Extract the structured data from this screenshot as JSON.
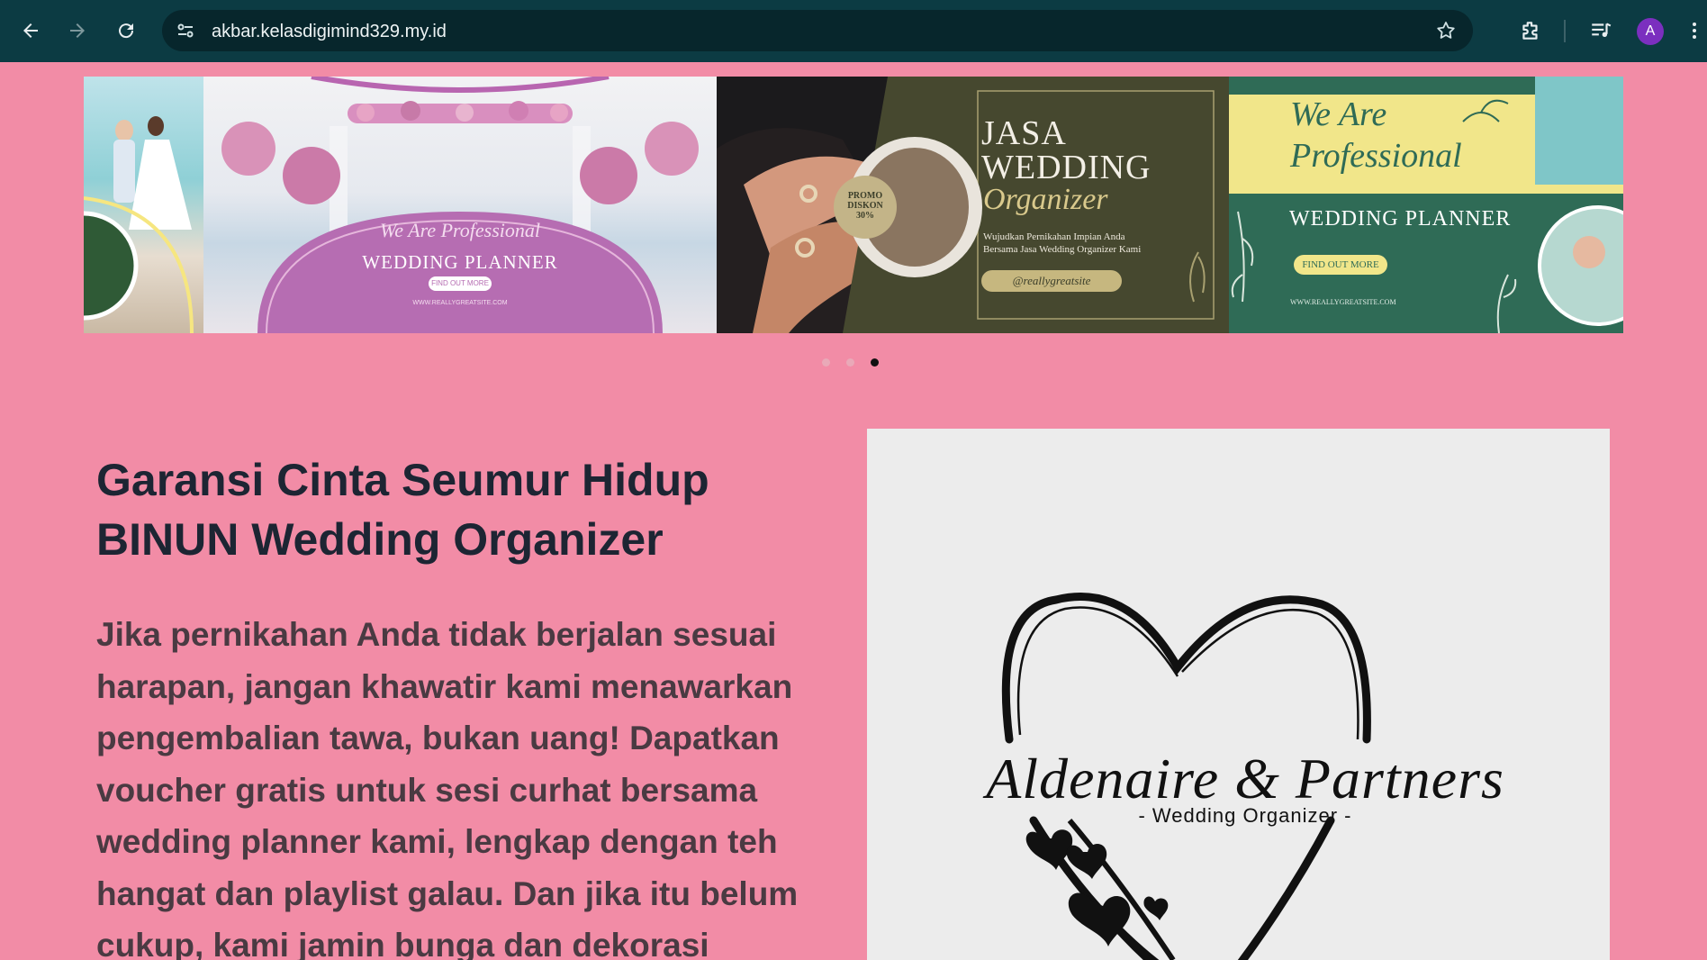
{
  "browser": {
    "url": "akbar.kelasdigimind329.my.id",
    "profile_initial": "A",
    "icons": [
      "back-icon",
      "forward-icon",
      "reload-icon",
      "site-info-icon",
      "bookmark-star-icon",
      "extensions-icon",
      "media-control-icon",
      "more-menu-icon"
    ]
  },
  "carousel": {
    "active_index": 2,
    "dot_count": 3,
    "slides": [
      {
        "script_line": "We Are Professional",
        "heading": "WEDDING PLANNER",
        "button": "FIND OUT MORE",
        "footer": "WWW.REALLYGREATSITE.COM"
      },
      {
        "heading_1": "JASA",
        "heading_2": "WEDDING",
        "script": "Organizer",
        "promo": [
          "PROMO",
          "DISKON",
          "30%"
        ],
        "tagline_1": "Wujudkan Pernikahan Impian Anda",
        "tagline_2": "Bersama Jasa Wedding Organizer Kami",
        "handle": "@reallygreatsite"
      },
      {
        "script_1": "We Are",
        "script_2": "Professional",
        "heading": "WEDDING PLANNER",
        "button": "FIND OUT MORE",
        "footer": "WWW.REALLYGREATSITE.COM"
      }
    ]
  },
  "hero": {
    "title_line1": "Garansi Cinta Seumur Hidup",
    "title_line2": "BINUN Wedding Organizer",
    "paragraph_lines": [
      "Jika pernikahan Anda tidak berjalan sesuai",
      "harapan, jangan khawatir kami menawarkan",
      "pengembalian tawa, bukan uang! Dapatkan",
      "voucher gratis untuk sesi curhat bersama",
      "wedding planner kami, lengkap dengan teh",
      "hangat dan playlist galau. Dan jika itu belum",
      "cukup, kami jamin bunga dan dekorasi"
    ]
  },
  "logo": {
    "brand": "Aldenaire & Partners",
    "subtitle": "- Wedding Organizer -"
  },
  "colors": {
    "page_bg": "#f28ca6",
    "chrome_bg": "#0c3b43",
    "title": "#1d2533",
    "paragraph": "#4a3a42"
  }
}
